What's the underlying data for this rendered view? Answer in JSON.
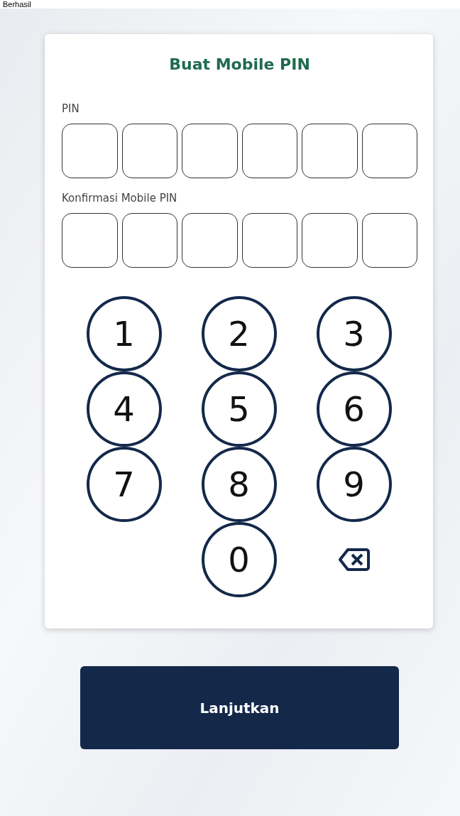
{
  "header": {
    "text": "Berhasil"
  },
  "title": "Buat Mobile PIN",
  "pin_fields": [
    {
      "label": "PIN",
      "boxes": [
        {
          "filled": false
        },
        {
          "filled": false
        },
        {
          "filled": false
        },
        {
          "filled": false
        },
        {
          "filled": false
        },
        {
          "filled": false
        }
      ]
    },
    {
      "label": "Konfirmasi Mobile PIN",
      "boxes": [
        {
          "filled": false
        },
        {
          "filled": false
        },
        {
          "filled": false
        },
        {
          "filled": false
        },
        {
          "filled": false
        },
        {
          "filled": false
        }
      ]
    }
  ],
  "keypad": [
    {
      "kind": "digit",
      "label": "1"
    },
    {
      "kind": "digit",
      "label": "2"
    },
    {
      "kind": "digit",
      "label": "3"
    },
    {
      "kind": "digit",
      "label": "4"
    },
    {
      "kind": "digit",
      "label": "5"
    },
    {
      "kind": "digit",
      "label": "6"
    },
    {
      "kind": "digit",
      "label": "7"
    },
    {
      "kind": "digit",
      "label": "8"
    },
    {
      "kind": "digit",
      "label": "9"
    },
    {
      "kind": "blank"
    },
    {
      "kind": "digit",
      "label": "0"
    },
    {
      "kind": "backspace"
    }
  ],
  "button": "Lanjutkan"
}
